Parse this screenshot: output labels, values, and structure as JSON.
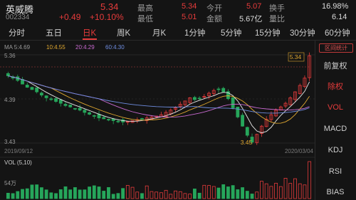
{
  "stock": {
    "name": "英威腾",
    "code": "002334",
    "price": "5.34",
    "change": "+0.49",
    "change_pct": "+10.10%"
  },
  "quote": {
    "high_label": "最高",
    "high": "5.34",
    "low_label": "最低",
    "low": "5.01",
    "open_label": "今开",
    "open": "5.07",
    "amount_label": "金额",
    "amount": "5.67亿",
    "turnover_label": "换手",
    "turnover": "16.98%",
    "ratio_label": "量比",
    "ratio": "6.14"
  },
  "tabs": [
    "分时",
    "五日",
    "日K",
    "周K",
    "月K",
    "1分钟",
    "5分钟",
    "15分钟",
    "30分钟",
    "60分钟"
  ],
  "active_tab": "日K",
  "ma_legend": {
    "ma5": "MA 5:4.69",
    "ma10": "10:4.55",
    "ma20": "20:4.29",
    "ma60": "60:4.30"
  },
  "chart_labels": {
    "y_top": "5.36",
    "y_mid": "4.39",
    "y_bottom": "3.43",
    "max_marker": "5.34",
    "min_marker": "3.45",
    "date_start": "2019/09/12",
    "date_end": "2020/03/04",
    "vol_legend": "VOL (5,10)",
    "vol_axis": "54万"
  },
  "sidebar": {
    "interval_stats": "区间统计",
    "items": [
      "前复权",
      "除权",
      "VOL",
      "MACD",
      "KDJ",
      "RSI",
      "BIAS"
    ],
    "active": "VOL"
  },
  "colors": {
    "up": "#e63b3b",
    "down": "#26a65b",
    "ma5": "#e8e8e8",
    "ma10": "#e0a830",
    "ma20": "#c86ad0",
    "ma60": "#6f8de0",
    "background": "#141414"
  },
  "chart_data": {
    "type": "candlestick",
    "y_range": [
      3.43,
      5.36
    ],
    "close_series": [
      4.9,
      4.85,
      4.8,
      4.72,
      4.65,
      4.6,
      4.55,
      4.48,
      4.42,
      4.38,
      4.34,
      4.3,
      4.25,
      4.22,
      4.18,
      4.15,
      4.1,
      4.06,
      4.02,
      3.98,
      3.96,
      3.94,
      3.92,
      3.9,
      3.89,
      3.9,
      3.92,
      3.94,
      3.96,
      3.98,
      4.0,
      4.02,
      4.05,
      4.1,
      4.15,
      4.2,
      4.28,
      4.35,
      4.42,
      4.38,
      4.4,
      4.45,
      4.52,
      4.58,
      4.6,
      4.55,
      4.4,
      4.2,
      4.0,
      3.8,
      3.6,
      3.45,
      3.62,
      3.8,
      3.95,
      4.05,
      4.15,
      4.22,
      4.3,
      4.42,
      4.55,
      4.69,
      4.85,
      5.34
    ]
  }
}
